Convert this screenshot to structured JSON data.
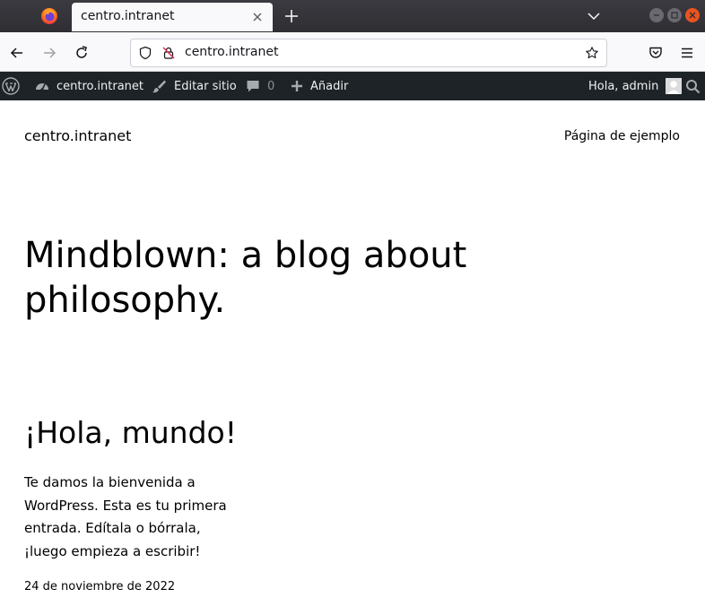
{
  "browser": {
    "tab": {
      "title": "centro.intranet"
    },
    "url": "centro.intranet"
  },
  "admin_bar": {
    "site_name": "centro.intranet",
    "edit_site": "Editar sitio",
    "comments_count": "0",
    "new_label": "Añadir",
    "greeting": "Hola, admin"
  },
  "site": {
    "title": "centro.intranet",
    "nav_link": "Página de ejemplo"
  },
  "hero": {
    "headline": "Mindblown: a blog about philosophy."
  },
  "post": {
    "title": "¡Hola, mundo!",
    "excerpt": "Te damos la bienvenida a WordPress. Esta es tu primera entrada. Edítala o bórrala, ¡luego empieza a escribir!",
    "date": "24 de noviembre de 2022"
  },
  "colors": {
    "tabstrip_bg": "#2f2e33",
    "admin_bar_bg": "#1d2327",
    "close_button": "#e9541f"
  },
  "icons": [
    "firefox-logo-icon",
    "close-icon",
    "plus-icon",
    "chevron-down-icon",
    "minimize-icon",
    "maximize-icon",
    "window-close-icon",
    "back-arrow-icon",
    "forward-arrow-icon",
    "reload-icon",
    "shield-icon",
    "insecure-lock-icon",
    "star-icon",
    "pocket-icon",
    "hamburger-menu-icon",
    "wordpress-logo-icon",
    "dashboard-icon",
    "brush-icon",
    "comment-icon",
    "plus-icon",
    "avatar",
    "search-icon"
  ]
}
